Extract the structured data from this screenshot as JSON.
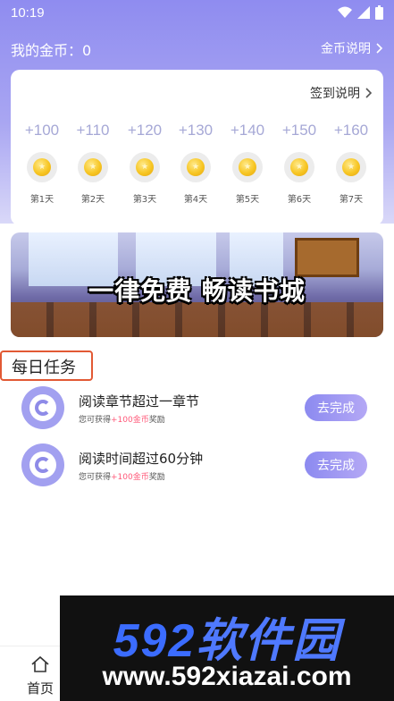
{
  "status_bar": {
    "time": "10:19"
  },
  "header": {
    "coins_label": "我的金币：0",
    "coin_explain": "金币说明"
  },
  "signin": {
    "explain_label": "签到说明",
    "days": [
      {
        "reward": "+100",
        "label": "第1天"
      },
      {
        "reward": "+110",
        "label": "第2天"
      },
      {
        "reward": "+120",
        "label": "第3天"
      },
      {
        "reward": "+130",
        "label": "第4天"
      },
      {
        "reward": "+140",
        "label": "第5天"
      },
      {
        "reward": "+150",
        "label": "第6天"
      },
      {
        "reward": "+160",
        "label": "第7天"
      }
    ]
  },
  "banner": {
    "title": "一律免费 畅读书城"
  },
  "tasks": {
    "title": "每日任务",
    "items": [
      {
        "name": "阅读章节超过一章节",
        "reward_prefix": "您可获得",
        "reward_value": "+100金币",
        "reward_suffix": "奖励",
        "button": "去完成"
      },
      {
        "name": "阅读时间超过60分钟",
        "reward_prefix": "您可获得",
        "reward_value": "+100金币",
        "reward_suffix": "奖励",
        "button": "去完成"
      }
    ]
  },
  "bottom_nav": {
    "home_label": "首页"
  },
  "watermark": {
    "logo_digits": "592",
    "logo_text": "软件园",
    "url": "www.592xiazai.com"
  },
  "colors": {
    "accent": "#8f8cf0",
    "reward_highlight": "#ff5a7a",
    "header_bg": "#a9a6f2"
  }
}
